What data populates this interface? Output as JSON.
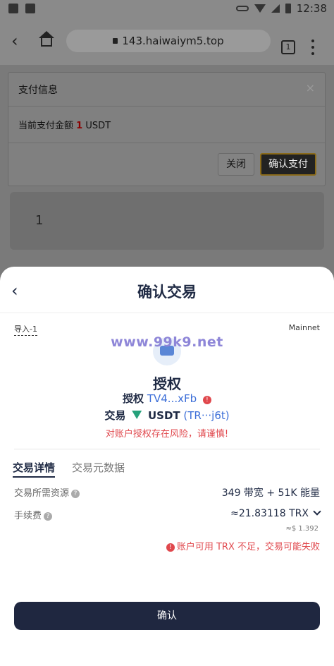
{
  "status_bar": {
    "time": "12:38"
  },
  "browser": {
    "url": "143.haiwaiym5.top",
    "tab_count": "1"
  },
  "pay_dialog": {
    "title": "支付信息",
    "close_symbol": "×",
    "amount_prefix": "当前支付金额",
    "amount_value": "1",
    "amount_unit": "USDT",
    "close_label": "关闭",
    "confirm_label": "确认支付"
  },
  "input_card": {
    "value": "1"
  },
  "sheet": {
    "title": "确认交易",
    "import_label": "导入-1",
    "network": "Mainnet",
    "watermark": "www.99k9.net",
    "action_title": "授权",
    "auth_key": "授权",
    "auth_value": "TV4...xFb",
    "trade_key": "交易",
    "token_symbol": "USDT",
    "token_address": "(TR···j6t)",
    "risk_warning": "对账户授权存在风险，请谨慎!",
    "tabs": {
      "detail": "交易详情",
      "metadata": "交易元数据"
    },
    "resource_label": "交易所需资源",
    "resource_value": "349 带宽 + 51K 能量",
    "fee_label": "手续费",
    "fee_value": "≈21.83118 TRX",
    "fee_usd": "≈$ 1.392",
    "fee_warning": "账户可用 TRX 不足，交易可能失败",
    "confirm_label": "确认"
  },
  "colors": {
    "primary": "#1f2a44",
    "link": "#3d6fd8",
    "danger": "#e0474c",
    "usdt": "#26a17b"
  }
}
